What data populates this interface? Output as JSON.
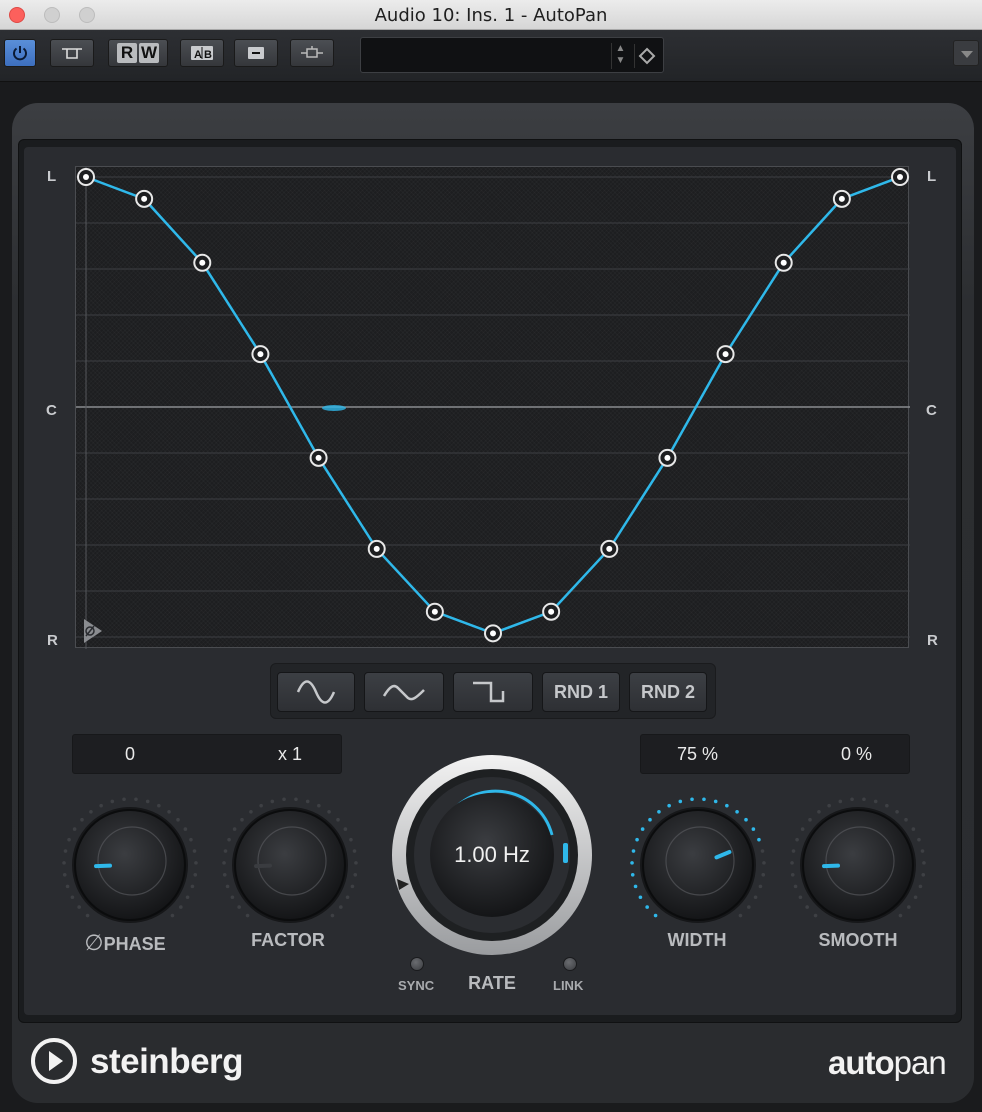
{
  "window": {
    "title": "Audio 10: Ins. 1 - AutoPan"
  },
  "toolbar": {
    "buttons": [
      "power-icon",
      "bypass-icon",
      "read-icon",
      "write-icon",
      "ab-compare-icon",
      "menu-icon",
      "sidechain-icon"
    ],
    "read_label": "R",
    "write_label": "W",
    "preset_name": ""
  },
  "graph": {
    "axis_left": {
      "top": "L",
      "middle": "C",
      "bottom": "R"
    },
    "axis_right": {
      "top": "L",
      "middle": "C",
      "bottom": "R"
    },
    "points": [
      {
        "pan": 1.0
      },
      {
        "pan": 0.905
      },
      {
        "pan": 0.627
      },
      {
        "pan": 0.23
      },
      {
        "pan": -0.221
      },
      {
        "pan": -0.617
      },
      {
        "pan": -0.89
      },
      {
        "pan": -0.984
      },
      {
        "pan": -0.89
      },
      {
        "pan": -0.617
      },
      {
        "pan": -0.221
      },
      {
        "pan": 0.23
      },
      {
        "pan": 0.627
      },
      {
        "pan": 0.905
      },
      {
        "pan": 1.0
      }
    ],
    "line_color": "#2fb8ea"
  },
  "waveforms": {
    "sine_icon": "sine-wave-icon",
    "triangle_icon": "triangle-wave-icon",
    "square_icon": "square-wave-icon",
    "rnd1": "RND 1",
    "rnd2": "RND 2"
  },
  "displays": {
    "phase_value": "0",
    "factor_value": "x 1",
    "width_value": "75 %",
    "smooth_value": "0 %"
  },
  "knobs": {
    "phase": {
      "label": "PHASE",
      "value": 0
    },
    "factor": {
      "label": "FACTOR",
      "value": 1
    },
    "rate": {
      "label": "RATE",
      "readout": "1.00 Hz"
    },
    "width": {
      "label": "WIDTH",
      "level": 0.75
    },
    "smooth": {
      "label": "SMOOTH",
      "level": 0.0
    }
  },
  "switches": {
    "sync": "SYNC",
    "link": "LINK"
  },
  "footer": {
    "brand": "steinberg",
    "product_bold": "auto",
    "product_light": "pan"
  },
  "colors": {
    "accent": "#2fb8ea",
    "panel": "#2a2c30"
  }
}
